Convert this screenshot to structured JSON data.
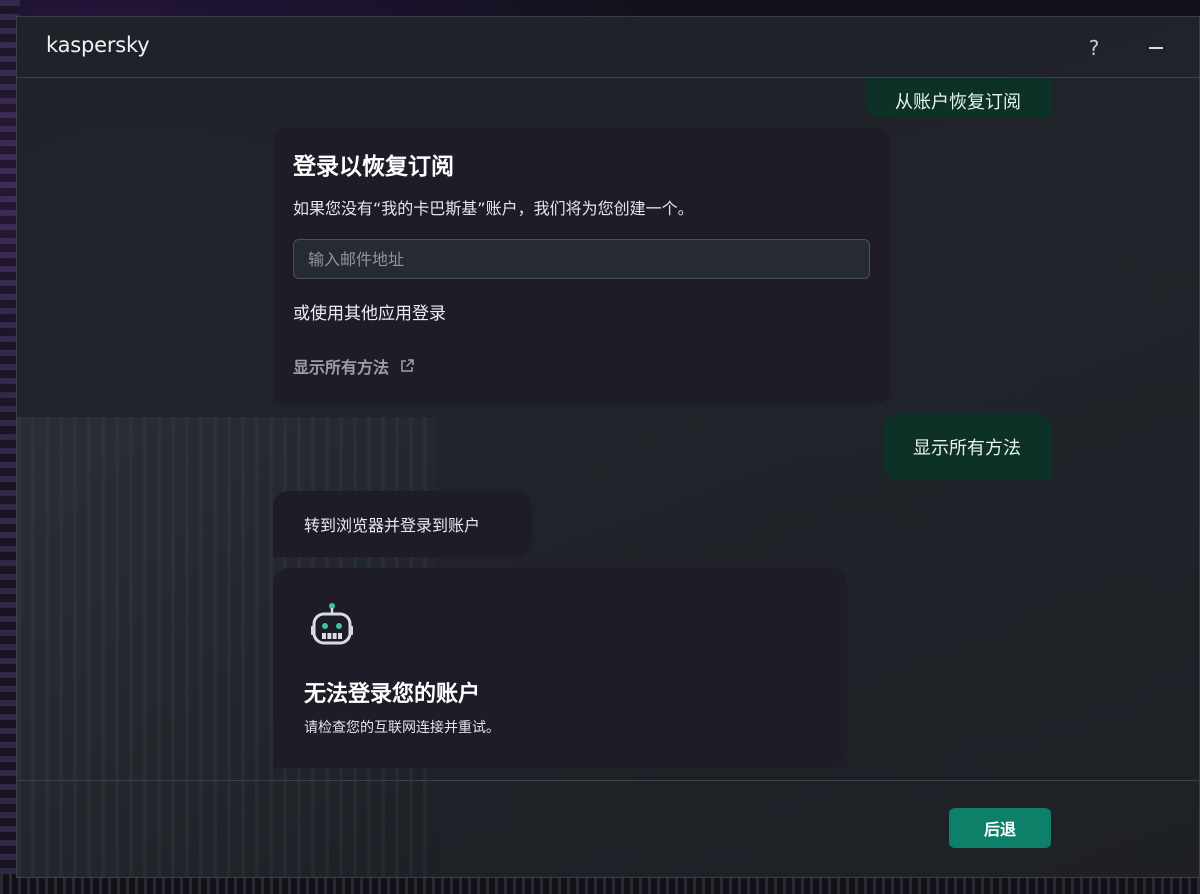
{
  "app": {
    "logo": "kaspersky"
  },
  "titlebar": {
    "help_label": "?"
  },
  "chat": {
    "user_messages": [
      "从账户恢复订阅",
      "显示所有方法"
    ],
    "login_card": {
      "title": "登录以恢复订阅",
      "subtitle": "如果您没有“我的卡巴斯基”账户，我们将为您创建一个。",
      "email_placeholder": "输入邮件地址",
      "email_value": "",
      "other_login": "或使用其他应用登录",
      "show_all_link": "显示所有方法",
      "show_all_icon": "external-link-icon"
    },
    "browser_message": "转到浏览器并登录到账户",
    "error_card": {
      "icon": "robot-icon",
      "title": "无法登录您的账户",
      "description": "请检查您的互联网连接并重试。"
    }
  },
  "footer": {
    "back_label": "后退"
  },
  "colors": {
    "accent": "#0e7f68",
    "user_bubble": "#0d3027",
    "card_bg": "#1e1d27",
    "robot_teal": "#3ec3a6"
  }
}
